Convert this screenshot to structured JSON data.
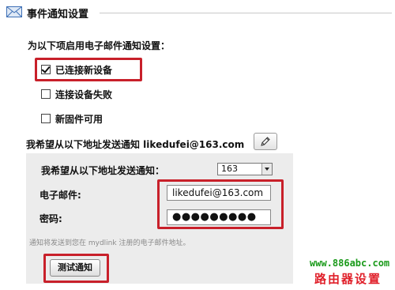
{
  "header": {
    "title": "事件通知设置",
    "icon": "mail-icon"
  },
  "section": {
    "label": "为以下项启用电子邮件通知设置："
  },
  "options": [
    {
      "label": "已连接新设备",
      "checked": true,
      "highlighted": true
    },
    {
      "label": "连接设备失败",
      "checked": false,
      "highlighted": false
    },
    {
      "label": "新固件可用",
      "checked": false,
      "highlighted": false
    }
  ],
  "address": {
    "line": "我希望从以下地址发送通知 likedufei@163.com",
    "edit_icon": "pencil-icon"
  },
  "panel": {
    "send_label": "我希望从以下地址发送通知：",
    "provider_value": "163",
    "email_label": "电子邮件:",
    "email_value": "likedufei@163.com",
    "password_label": "密码:",
    "password_value": "●●●●●●●●●",
    "hint": "通知将发送到您在 mydlink 注册的电子邮件地址。",
    "test_button": "测试通知"
  },
  "watermark": {
    "url": "www.886abc.com",
    "text": "路由器设置"
  },
  "colors": {
    "highlight": "#c8202a",
    "panel_bg": "#ececec",
    "watermark_green": "#1a9a1a",
    "watermark_red": "#e0202a"
  }
}
